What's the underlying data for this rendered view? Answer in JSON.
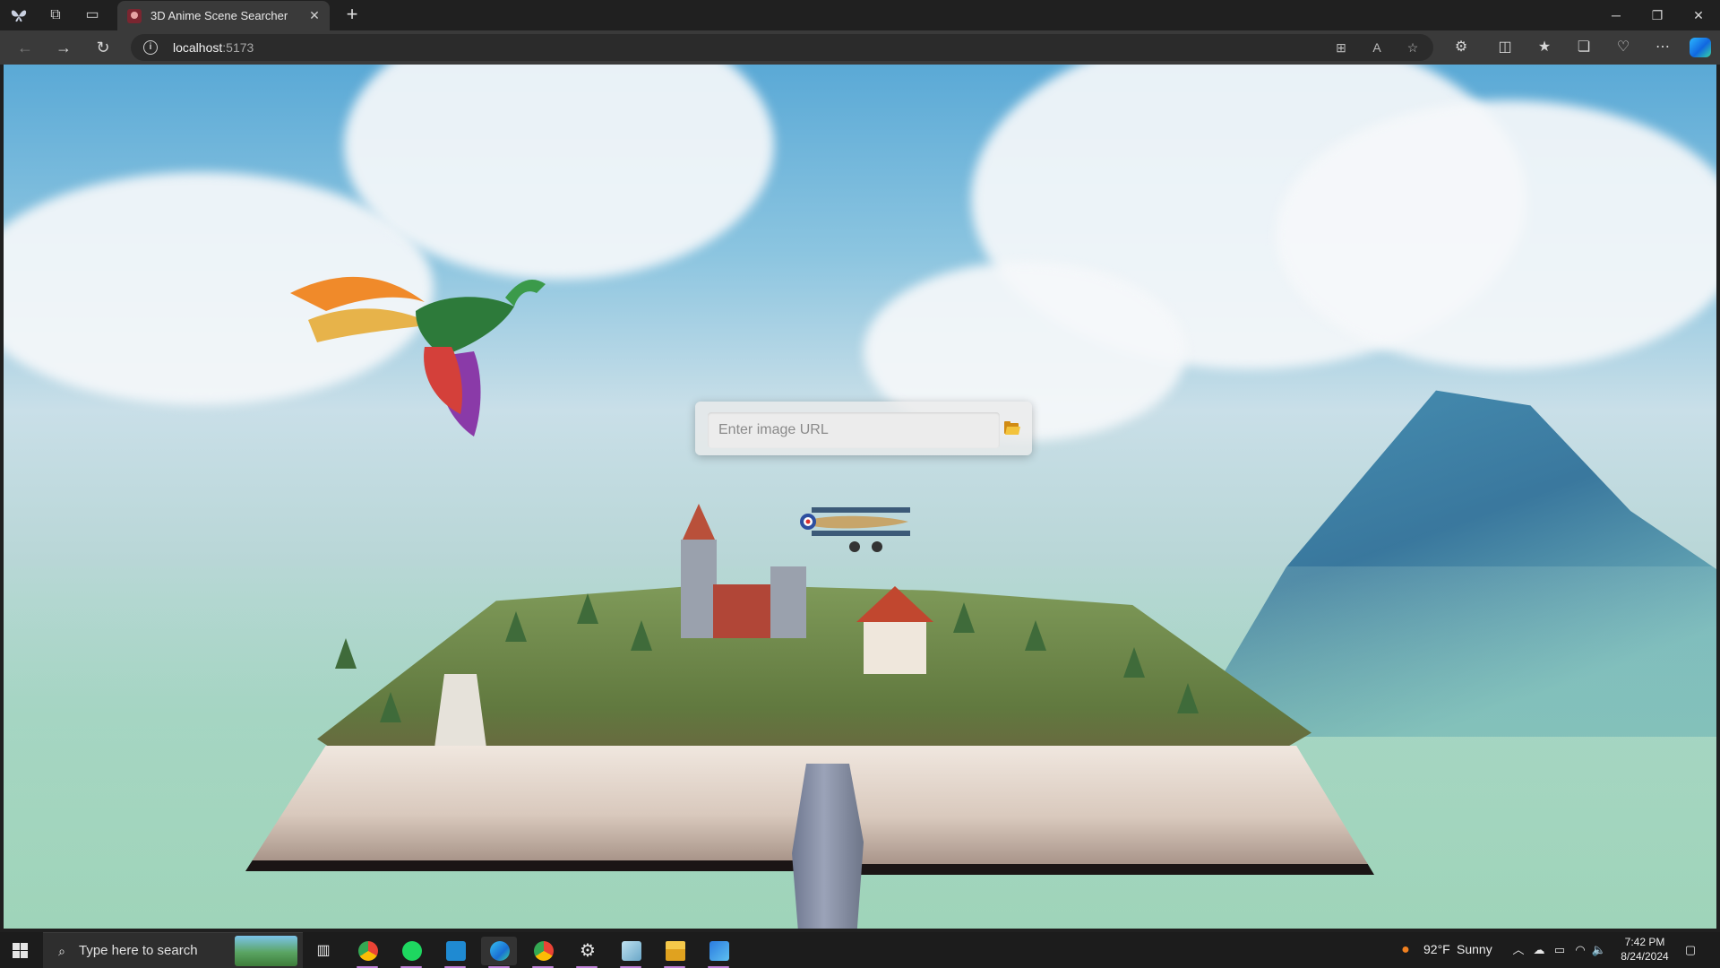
{
  "browser": {
    "tab": {
      "title": "3D Anime Scene Searcher"
    },
    "address": {
      "host": "localhost",
      "port": ":5173"
    }
  },
  "page": {
    "search": {
      "placeholder": "Enter image URL",
      "value": ""
    }
  },
  "taskbar": {
    "search_placeholder": "Type here to search",
    "weather": {
      "temp": "92°F",
      "condition": "Sunny"
    },
    "clock": {
      "time": "7:42 PM",
      "date": "8/24/2024"
    }
  },
  "colors": {
    "accent": "#c083d8",
    "folder": "#f3c33c",
    "sky": "#8cc5e0"
  }
}
